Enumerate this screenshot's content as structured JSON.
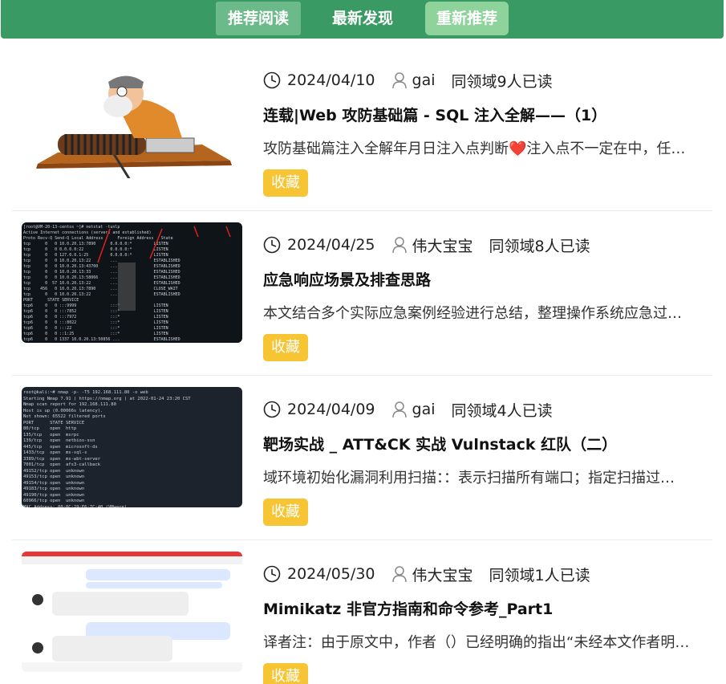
{
  "tabs": [
    {
      "label": "推荐阅读"
    },
    {
      "label": "最新发现"
    },
    {
      "label": "重新推荐"
    }
  ],
  "articles": [
    {
      "date": "2024/04/10",
      "author": "gai",
      "readers": "同领域9人已读",
      "title": "连载|Web 攻防基础篇 - SQL 注入全解——（1）",
      "summary": "攻防基础篇注入全解年月日注入点判断❤️注入点不一定在中，任…",
      "fav_label": "收藏",
      "thumb": "cartoon-old-man-winch"
    },
    {
      "date": "2024/04/25",
      "author": "伟大宝宝",
      "readers": "同领域8人已读",
      "title": "应急响应场景及排查思路",
      "summary": "本文结合多个实际应急案例经验进行总结，整理操作系统应急过…",
      "fav_label": "收藏",
      "thumb": "netstat-terminal"
    },
    {
      "date": "2024/04/09",
      "author": "gai",
      "readers": "同领域4人已读",
      "title": "靶场实战 _ ATT&CK 实战 Vulnstack 红队（二）",
      "summary": "域环境初始化漏洞利用扫描：：表示扫描所有端口；指定扫描过…",
      "fav_label": "收藏",
      "thumb": "nmap-terminal"
    },
    {
      "date": "2024/05/30",
      "author": "伟大宝宝",
      "readers": "同领域1人已读",
      "title": "Mimikatz 非官方指南和命令参考_Part1",
      "summary": "译者注：由于原文中，作者（）已经明确的指出“未经本文作者明…",
      "fav_label": "收藏",
      "thumb": "chat-screenshot"
    }
  ],
  "colors": {
    "topbar": "#3a9a63",
    "fav_button": "#f7c533"
  }
}
